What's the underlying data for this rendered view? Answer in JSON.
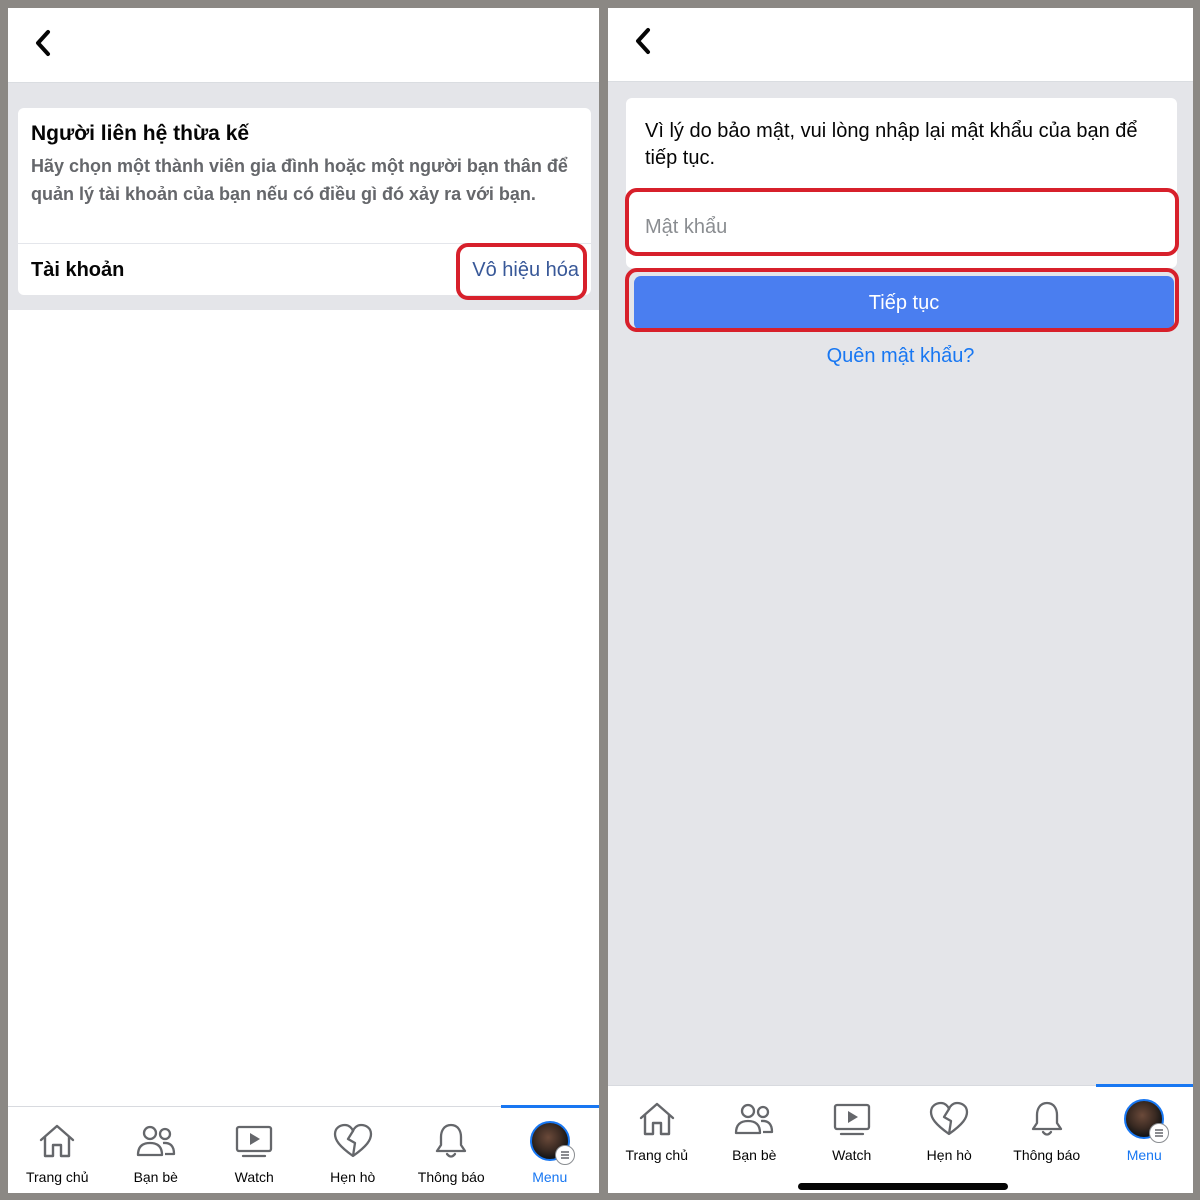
{
  "left_screen": {
    "card": {
      "title": "Người liên hệ thừa kế",
      "description": "Hãy chọn một thành viên gia đình hoặc một người bạn thân để quản lý tài khoản của bạn nếu có điều gì đó xảy ra với bạn.",
      "row_label": "Tài khoản",
      "row_action": "Vô hiệu hóa"
    }
  },
  "right_screen": {
    "message": "Vì lý do bảo mật, vui lòng nhập lại mật khẩu của bạn để tiếp tục.",
    "password_placeholder": "Mật khẩu",
    "continue_label": "Tiếp tục",
    "forgot_link": "Quên mật khẩu?"
  },
  "nav": {
    "items": [
      {
        "label": "Trang chủ",
        "icon": "home-icon"
      },
      {
        "label": "Bạn bè",
        "icon": "friends-icon"
      },
      {
        "label": "Watch",
        "icon": "watch-icon"
      },
      {
        "label": "Hẹn hò",
        "icon": "dating-heart-icon"
      },
      {
        "label": "Thông báo",
        "icon": "bell-icon"
      },
      {
        "label": "Menu",
        "icon": "profile-avatar",
        "active": true
      }
    ]
  },
  "colors": {
    "highlight": "#d7202b",
    "primary": "#4a7ef0",
    "link": "#1877f2",
    "action_text": "#385898",
    "background": "#e4e5e9"
  }
}
